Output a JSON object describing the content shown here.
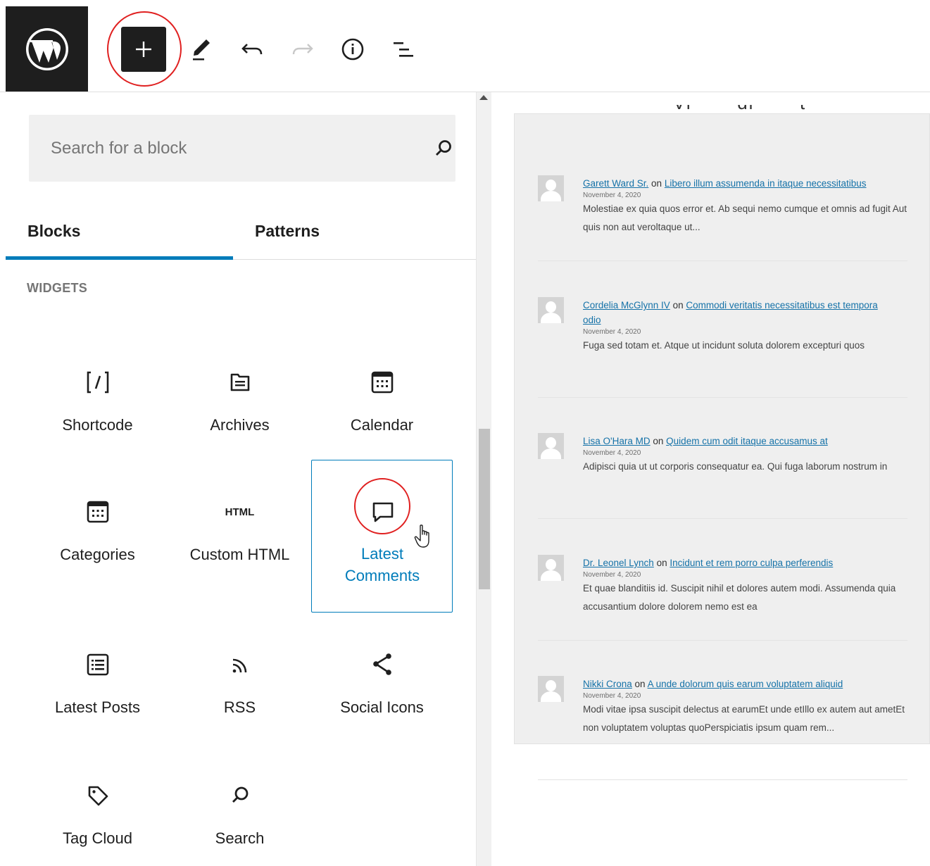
{
  "toolbar": {
    "logo_alt": "WordPress",
    "inserter_icon": "plus-icon",
    "tools_icon": "pencil-icon",
    "undo_icon": "undo-icon",
    "redo_icon": "redo-icon",
    "info_icon": "info-icon",
    "outline_icon": "list-view-icon"
  },
  "inserter": {
    "search_placeholder": "Search for a block",
    "tabs": {
      "blocks": "Blocks",
      "patterns": "Patterns"
    },
    "active_tab": "Blocks",
    "section_title": "WIDGETS",
    "blocks": [
      {
        "label": "Shortcode",
        "icon": "shortcode-icon"
      },
      {
        "label": "Archives",
        "icon": "archive-icon"
      },
      {
        "label": "Calendar",
        "icon": "calendar-icon"
      },
      {
        "label": "Categories",
        "icon": "categories-icon"
      },
      {
        "label": "Custom HTML",
        "icon": "html-icon",
        "icon_text": "HTML"
      },
      {
        "label": "Latest Comments",
        "icon": "comment-icon",
        "selected": true
      },
      {
        "label": "Latest Posts",
        "icon": "post-list-icon"
      },
      {
        "label": "RSS",
        "icon": "rss-icon"
      },
      {
        "label": "Social Icons",
        "icon": "share-icon"
      },
      {
        "label": "Tag Cloud",
        "icon": "tag-icon"
      },
      {
        "label": "Search",
        "icon": "search-icon"
      }
    ]
  },
  "preview": {
    "connector": "on",
    "comments": [
      {
        "author": "Garett Ward Sr.",
        "post": "Libero illum assumenda in itaque necessitatibus",
        "date": "November 4, 2020",
        "excerpt": "Molestiae ex quia quos error et. Ab sequi nemo cumque et omnis ad fugit Aut quis non aut veroltaque ut..."
      },
      {
        "author": "Cordelia McGlynn IV",
        "post": "Commodi veritatis necessitatibus est tempora odio",
        "date": "November 4, 2020",
        "excerpt": "Fuga sed totam et. Atque ut incidunt soluta dolorem excepturi quos"
      },
      {
        "author": "Lisa O'Hara MD",
        "post": "Quidem cum odit itaque accusamus at",
        "date": "November 4, 2020",
        "excerpt": "Adipisci quia ut ut corporis consequatur ea. Qui fuga laborum nostrum in"
      },
      {
        "author": "Dr. Leonel Lynch",
        "post": "Incidunt et rem porro culpa perferendis",
        "date": "November 4, 2020",
        "excerpt": "Et quae blanditiis id. Suscipit nihil et dolores autem modi. Assumenda quia accusantium dolore dolorem nemo est ea"
      },
      {
        "author": "Nikki Crona",
        "post": "A unde dolorum quis earum voluptatem aliquid",
        "date": "November 4, 2020",
        "excerpt": "Modi vitae ipsa suscipit delectus at earumEt unde etIllo ex autem aut ametEt non voluptatem voluptas quoPerspiciatis ipsum quam rem..."
      }
    ]
  },
  "colors": {
    "accent": "#007cba",
    "annotation_ring": "#e02020",
    "toolbar_dark": "#1e1e1e",
    "link": "#1572a8"
  }
}
